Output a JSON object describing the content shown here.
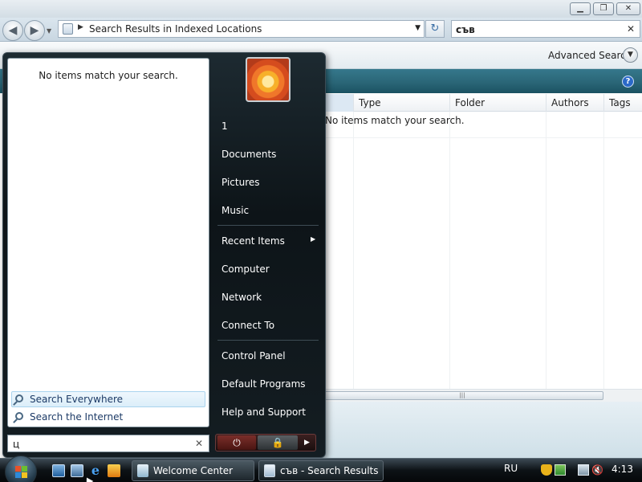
{
  "explorer": {
    "window_controls": {
      "minimize": "▁",
      "maximize": "❐",
      "close": "✕"
    },
    "nav": {
      "back": "◀",
      "forward": "▶",
      "recent": "▼"
    },
    "address": {
      "arrow": "▶",
      "text": "Search Results in Indexed Locations",
      "dropdown": "▼"
    },
    "refresh": "↻",
    "search": {
      "value": "съв",
      "clear": "✕"
    },
    "toolbar": {
      "advanced_search_label": "Advanced Search",
      "toggle": "▼"
    },
    "help": "?",
    "columns": [
      "",
      "Type",
      "Folder",
      "Authors",
      "Tags"
    ],
    "list": {
      "empty_message": "No items match your search."
    },
    "scroll_thumb": "|||"
  },
  "start_menu": {
    "left_pane": {
      "empty_message": "No items match your search.",
      "search_everywhere": "Search Everywhere",
      "search_internet": "Search the Internet"
    },
    "search_box": {
      "value": "ц",
      "clear": "✕"
    },
    "right_pane": {
      "user": "1",
      "documents": "Documents",
      "pictures": "Pictures",
      "music": "Music",
      "recent_items": "Recent Items",
      "recent_arrow": "▶",
      "computer": "Computer",
      "network": "Network",
      "connect_to": "Connect To",
      "control_panel": "Control Panel",
      "default_programs": "Default Programs",
      "help_support": "Help and Support"
    },
    "power": {
      "power": "⏻",
      "lock": "🔒",
      "more": "▶"
    }
  },
  "taskbar": {
    "tasks": [
      "Welcome Center",
      "съв - Search Results ..."
    ],
    "language": "RU",
    "volume": "🔇",
    "clock": "4:13"
  }
}
